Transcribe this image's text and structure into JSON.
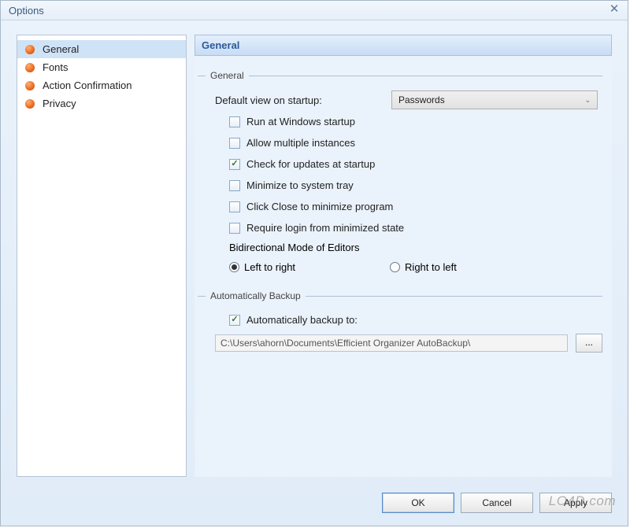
{
  "window": {
    "title": "Options"
  },
  "sidebar": {
    "items": [
      {
        "label": "General",
        "selected": true
      },
      {
        "label": "Fonts",
        "selected": false
      },
      {
        "label": "Action Confirmation",
        "selected": false
      },
      {
        "label": "Privacy",
        "selected": false
      }
    ]
  },
  "panel": {
    "title": "General",
    "group_general": {
      "title": "General",
      "default_view_label": "Default view on startup:",
      "default_view_value": "Passwords",
      "chk_run_startup": {
        "label": "Run at Windows startup",
        "checked": false
      },
      "chk_multi_instance": {
        "label": "Allow multiple instances",
        "checked": false
      },
      "chk_updates": {
        "label": "Check for updates at startup",
        "checked": true
      },
      "chk_min_tray": {
        "label": "Minimize to system tray",
        "checked": false
      },
      "chk_close_min": {
        "label": "Click Close to minimize program",
        "checked": false
      },
      "chk_login_min": {
        "label": "Require login from minimized state",
        "checked": false
      },
      "bidi_label": "Bidirectional Mode of Editors",
      "bidi_ltr": "Left to right",
      "bidi_rtl": "Right to left",
      "bidi_value": "ltr"
    },
    "group_backup": {
      "title": "Automatically Backup",
      "chk_auto": {
        "label": "Automatically backup to:",
        "checked": true
      },
      "path": "C:\\Users\\ahorn\\Documents\\Efficient Organizer AutoBackup\\",
      "browse": "..."
    }
  },
  "buttons": {
    "ok": "OK",
    "cancel": "Cancel",
    "apply": "Apply"
  },
  "watermark": "LO4D.com"
}
